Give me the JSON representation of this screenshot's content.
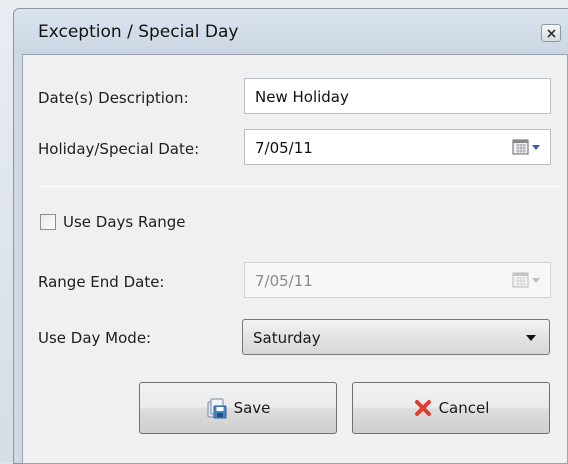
{
  "dialog": {
    "title": "Exception / Special Day",
    "close_label": "✕"
  },
  "form": {
    "description_label": "Date(s) Description:",
    "description_value": "New Holiday",
    "date_label": "Holiday/Special Date:",
    "date_value": "7/05/11",
    "use_range_label": "Use Days Range",
    "use_range_checked": false,
    "range_end_label": "Range End Date:",
    "range_end_value": "7/05/11",
    "day_mode_label": "Use Day Mode:",
    "day_mode_value": "Saturday"
  },
  "buttons": {
    "save_label": "Save",
    "cancel_label": "Cancel"
  },
  "icons": {
    "save": "save-icon",
    "cancel": "cancel-icon",
    "calendar": "calendar-icon",
    "dropdown": "chevron-down-icon"
  },
  "colors": {
    "cancel_icon": "#e23b2e",
    "calendar_accent": "#2f5fa8"
  }
}
